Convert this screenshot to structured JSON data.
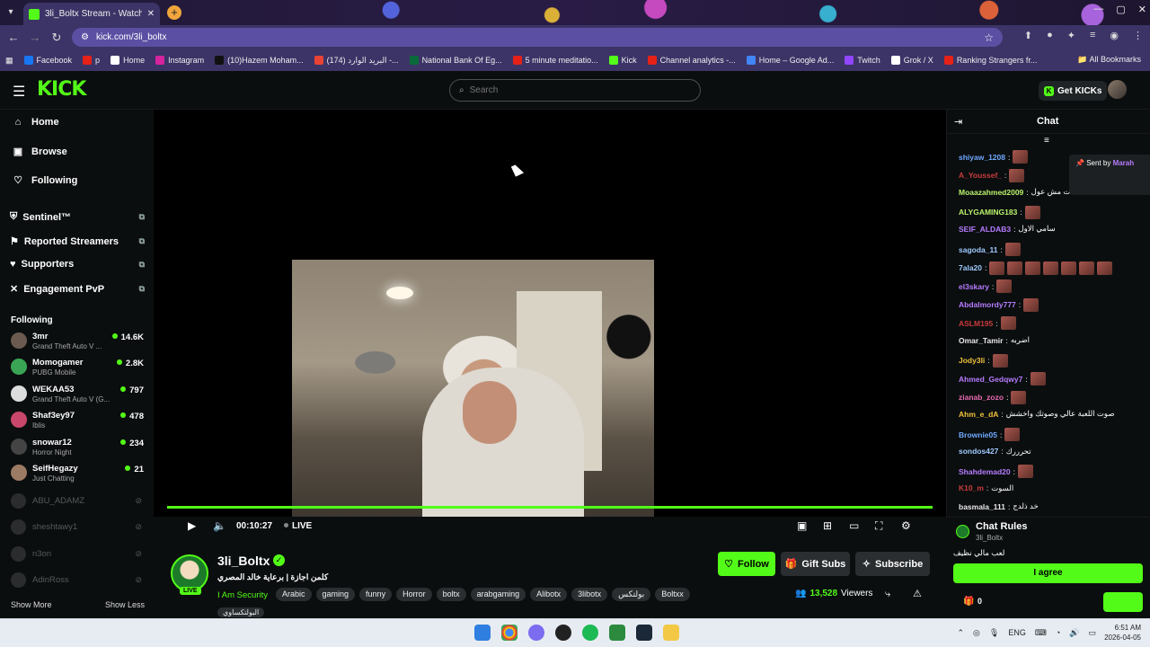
{
  "browser": {
    "tab_title": "3li_Boltx Stream - Watch Li...",
    "url": "kick.com/3li_boltx",
    "bookmarks": [
      "Facebook",
      "p",
      "Home",
      "Instagram",
      "(10)Hazem Moham...",
      "(174) البريد الوارد -...",
      "National Bank Of Eg...",
      "5 minute meditatio...",
      "Kick",
      "Channel analytics -...",
      "Home – Google Ad...",
      "Twitch",
      "Grok / X",
      "Ranking Strangers fr..."
    ],
    "all_bookmarks": "All Bookmarks"
  },
  "header": {
    "logo": "KICK",
    "search_placeholder": "Search",
    "get_kicks": "Get KICKs"
  },
  "sidebar": {
    "nav": [
      {
        "label": "Home",
        "icon": "home-icon"
      },
      {
        "label": "Browse",
        "icon": "browse-icon"
      },
      {
        "label": "Following",
        "icon": "heart-icon"
      }
    ],
    "tools": [
      {
        "label": "Sentinel™",
        "icon": "shield-icon"
      },
      {
        "label": "Reported Streamers",
        "icon": "flag-icon"
      },
      {
        "label": "Supporters",
        "icon": "heart-icon"
      },
      {
        "label": "Engagement PvP",
        "icon": "swords-icon"
      }
    ],
    "following_heading": "Following",
    "following_live": [
      {
        "name": "3mr",
        "game": "Grand Theft Auto V ...",
        "viewers": "14.6K",
        "color": "#6b5a4f"
      },
      {
        "name": "Momogamer",
        "game": "PUBG Mobile",
        "viewers": "2.8K",
        "color": "#3aa655"
      },
      {
        "name": "WEKAA53",
        "game": "Grand Theft Auto V (G...",
        "viewers": "797",
        "color": "#dddddd"
      },
      {
        "name": "Shaf3ey97",
        "game": "Iblis",
        "viewers": "478",
        "color": "#c9476a"
      },
      {
        "name": "snowar12",
        "game": "Horror Night",
        "viewers": "234",
        "color": "#444444"
      },
      {
        "name": "SeifHegazy",
        "game": "Just Chatting",
        "viewers": "21",
        "color": "#9c7b64"
      }
    ],
    "following_offline": [
      "ABU_ADAMZ",
      "sheshtawy1",
      "n3on",
      "AdinRoss"
    ],
    "show_more": "Show More",
    "show_less": "Show Less"
  },
  "player": {
    "time": "00:10:27",
    "live_label": "LIVE"
  },
  "stream": {
    "channel": "3li_Boltx",
    "live_badge": "LIVE",
    "title": "كلمن اجازة | برعاية خالد المصري",
    "category": "I Am Security",
    "tags": [
      "Arabic",
      "gaming",
      "funny",
      "Horror",
      "boltx",
      "arabgaming",
      "Alibotx",
      "3libotx",
      "بولتكس",
      "Boltxx"
    ],
    "extra_tag": "البولتكساوي",
    "follow": "Follow",
    "gift_subs": "Gift Subs",
    "subscribe": "Subscribe",
    "viewers_count": "13,528",
    "viewers_label": "Viewers"
  },
  "chat": {
    "title": "Chat",
    "pinned_label": "Sent by",
    "pinned_user": "Marah",
    "messages": [
      {
        "user": "shiyaw_1208",
        "text": "",
        "emotes": 1,
        "color": "#6fa8ff"
      },
      {
        "user": "A_Youssef_",
        "text": "",
        "emotes": 1,
        "color": "#c93c3c"
      },
      {
        "user": "Moaazahmed2009",
        "text": "ت مش عول",
        "emotes": 0,
        "color": "#b9f36b"
      },
      {
        "user": "ALYGAMING183",
        "text": "",
        "emotes": 1,
        "color": "#b9f36b"
      },
      {
        "user": "SEIF_ALDAB3",
        "text": "سامي الاول",
        "emotes": 0,
        "color": "#b67cff"
      },
      {
        "user": "sagoda_11",
        "text": "",
        "emotes": 1,
        "color": "#9ecbff"
      },
      {
        "user": "7ala20",
        "text": "",
        "emotes": 7,
        "color": "#9ecbff"
      },
      {
        "user": "el3skary",
        "text": "",
        "emotes": 1,
        "color": "#b67cff"
      },
      {
        "user": "Abdalmordy777",
        "text": "",
        "emotes": 1,
        "color": "#b67cff"
      },
      {
        "user": "ASLM195",
        "text": "",
        "emotes": 1,
        "color": "#c93c3c"
      },
      {
        "user": "Omar_Tamir",
        "text": "اضربه",
        "emotes": 0,
        "color": "#e8e8e8"
      },
      {
        "user": "Jody3li",
        "text": "",
        "emotes": 1,
        "color": "#f0c23c"
      },
      {
        "user": "Ahmed_Gedqwy7",
        "text": "",
        "emotes": 1,
        "color": "#b67cff"
      },
      {
        "user": "zianab_zozo",
        "text": "",
        "emotes": 1,
        "color": "#e86bb0"
      },
      {
        "user": "Ahm_e_dA",
        "text": "صوت اللعبة عالي وصوتك واخشش",
        "emotes": 0,
        "color": "#f0c23c"
      },
      {
        "user": "Brownie05",
        "text": "",
        "emotes": 1,
        "color": "#6fa8ff"
      },
      {
        "user": "sondos427",
        "text": "تحرررك",
        "emotes": 0,
        "color": "#9ecbff"
      },
      {
        "user": "Shahdemad20",
        "text": "",
        "emotes": 1,
        "color": "#b67cff"
      },
      {
        "user": "K10_m",
        "text": "السوت",
        "emotes": 0,
        "color": "#c93c3c"
      },
      {
        "user": "basmala_111",
        "text": "خد ذلدج",
        "emotes": 0,
        "color": "#e8e8e8"
      }
    ],
    "rules_title": "Chat Rules",
    "rules_channel": "3li_Boltx",
    "rules_text": "لعب مالي نظيف",
    "agree": "I agree",
    "kicks_count": "0"
  },
  "taskbar": {
    "lang": "ENG",
    "time": "6:51 AM",
    "date": "2026-04-05"
  },
  "colors": {
    "accent": "#53fc18",
    "bg": "#0b0e0f"
  }
}
